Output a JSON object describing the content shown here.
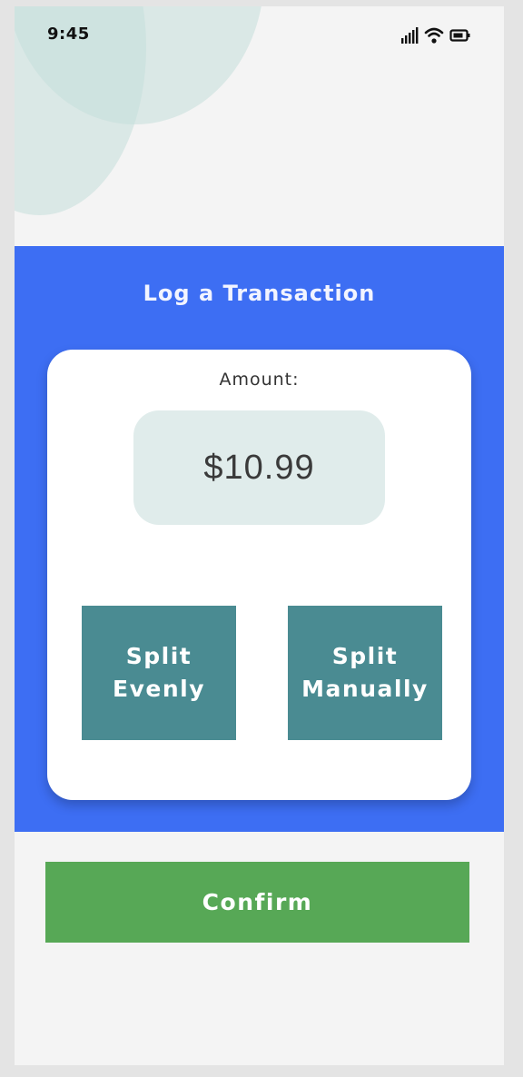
{
  "status_bar": {
    "time": "9:45",
    "icons": [
      "cellular-signal-icon",
      "wifi-icon",
      "battery-icon"
    ]
  },
  "screen": {
    "title": "Log a Transaction",
    "amount_label": "Amount:",
    "amount_value": "$10.99",
    "split_evenly_label": "Split\nEvenly",
    "split_manually_label": "Split\nManually",
    "confirm_label": "Confirm"
  },
  "colors": {
    "background": "#f4f4f4",
    "panel": "#3d6ef3",
    "card": "#ffffff",
    "amount_box": "#e0eceb",
    "split_button": "#4a8b92",
    "confirm_button": "#57a856"
  }
}
